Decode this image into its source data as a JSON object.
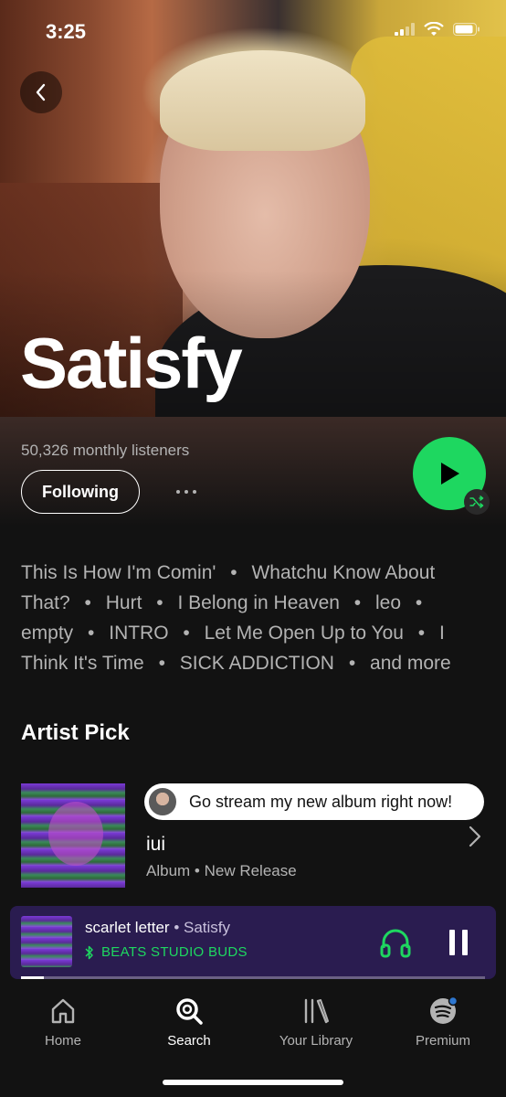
{
  "status_bar": {
    "time": "3:25"
  },
  "artist": {
    "name": "Satisfy",
    "monthly_listeners": "50,326 monthly listeners",
    "following_label": "Following"
  },
  "popular_tracks": {
    "items": [
      "This Is How I'm Comin'",
      "Whatchu Know About That?",
      "Hurt",
      "I Belong in Heaven",
      "leo",
      "empty",
      "INTRO",
      "Let Me Open Up to You",
      "I Think It's Time",
      "SICK ADDICTION"
    ],
    "more_label": "and more",
    "separator": "•"
  },
  "artist_pick": {
    "section_title": "Artist Pick",
    "comment": "Go stream my new album right now!",
    "title": "iui",
    "subtitle": "Album • New Release"
  },
  "now_playing": {
    "track": "scarlet letter",
    "separator": " • ",
    "artist": "Satisfy",
    "device": "BEATS STUDIO BUDS",
    "progress": 0.05
  },
  "bottom_nav": {
    "items": [
      {
        "label": "Home",
        "icon": "home-icon"
      },
      {
        "label": "Search",
        "icon": "search-icon"
      },
      {
        "label": "Your Library",
        "icon": "library-icon"
      },
      {
        "label": "Premium",
        "icon": "spotify-icon"
      }
    ],
    "active": "Search"
  },
  "colors": {
    "accent": "#1ed760",
    "background": "#121212",
    "now_playing_bg": "#2a1c50"
  }
}
